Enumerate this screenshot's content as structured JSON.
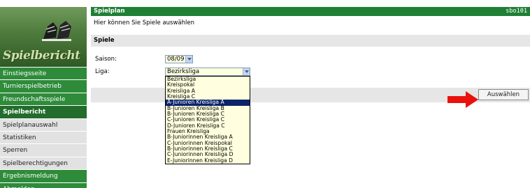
{
  "logo": {
    "text": "Spielbericht"
  },
  "nav": {
    "items": [
      {
        "label": "Einstiegsseite",
        "style": "green"
      },
      {
        "label": "Turnierspielbetrieb",
        "style": "green"
      },
      {
        "label": "Freundschaftsspiele",
        "style": "green"
      },
      {
        "label": "Spielbericht",
        "style": "active"
      },
      {
        "label": "Spielplanauswahl",
        "style": "grey"
      },
      {
        "label": "Statistiken",
        "style": "grey"
      },
      {
        "label": "Sperren",
        "style": "grey"
      },
      {
        "label": "Spielberechtigungen",
        "style": "grey"
      },
      {
        "label": "Ergebnismeldung",
        "style": "green"
      },
      {
        "label": "Abmelden",
        "style": "green"
      }
    ]
  },
  "header": {
    "title": "Spielplan",
    "user": "sbo101"
  },
  "subtitle": "Hier können Sie Spiele auswählen",
  "section": {
    "title": "Spiele"
  },
  "form": {
    "saison_label": "Saison:",
    "saison_value": "08/09",
    "liga_label": "Liga:",
    "liga_value": "Bezirksliga"
  },
  "dropdown": {
    "selected_index": 4,
    "options": [
      "Bezirksliga",
      "Kreispokal",
      "Kreisliga A",
      "Kreisliga C",
      "A-Junioren Kreisliga A",
      "B-Junioren Kreisliga B",
      "B-Junioren Kreisliga C",
      "C-Junioren Kreisliga C",
      "D-Junioren Kreisliga C",
      "Frauen Kreisliga",
      "B-Juniorinnen Kreisliga A",
      "C-Juniorinnen Kreispokal",
      "B-Juniorinnen Kreisliga C",
      "C-Juniorinnen Kreisliga D",
      "E-Juniorinnen Kreisliga D"
    ]
  },
  "actions": {
    "submit_label": "Auswählen"
  },
  "colors": {
    "nav_green": "#2e8b3a",
    "header_green": "#1f7f35",
    "highlight": "#0a246a",
    "arrow": "#e8120c"
  }
}
